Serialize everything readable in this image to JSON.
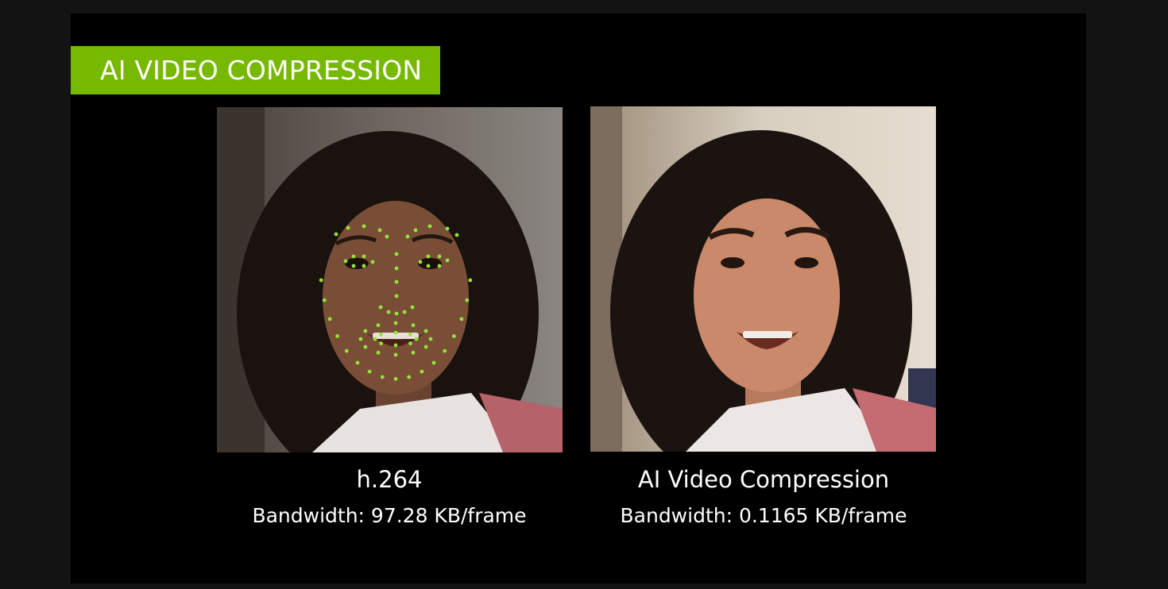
{
  "banner": {
    "title": "AI VIDEO COMPRESSION",
    "color": "#76b900"
  },
  "panels": [
    {
      "codec": "h.264",
      "bandwidth": "Bandwidth: 97.28 KB/frame",
      "skin": "#7a4e36",
      "landmarks": true
    },
    {
      "codec": "AI Video Compression",
      "bandwidth": "Bandwidth: 0.1165 KB/frame",
      "skin": "#c9896a",
      "landmarks": false
    }
  ],
  "colors": {
    "landmark": "#8fe63a",
    "background": "#000000"
  }
}
